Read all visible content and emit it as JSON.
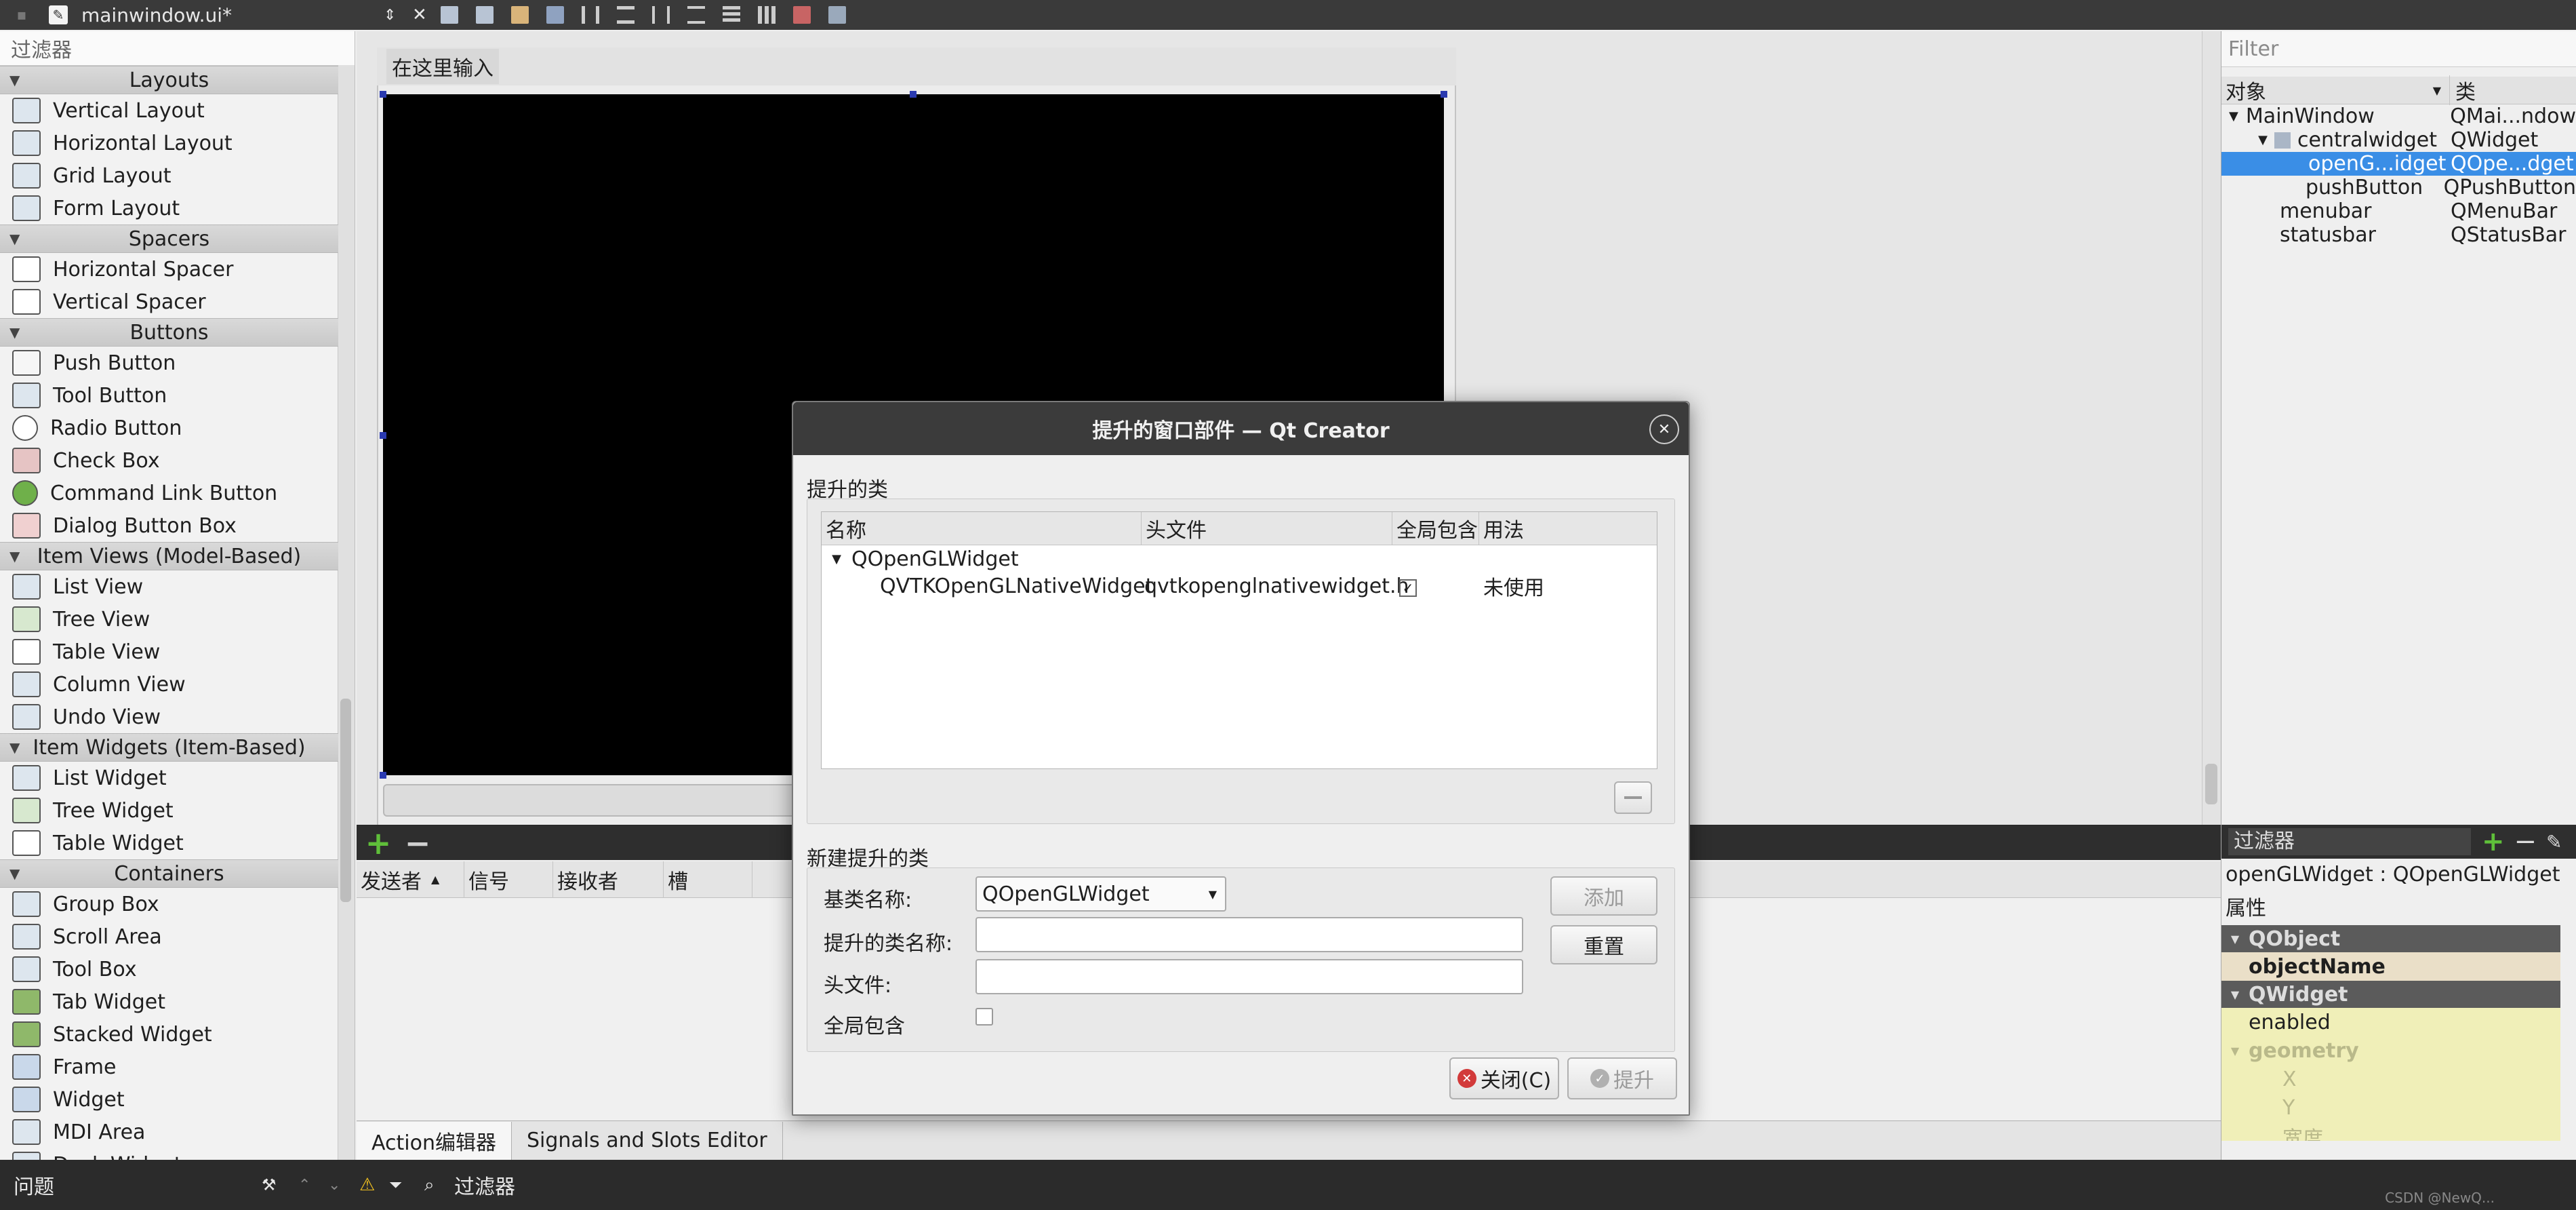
{
  "topbar": {
    "file_tab": "mainwindow.ui*"
  },
  "widgetbox": {
    "filter_placeholder": "过滤器",
    "categories": {
      "layouts": "Layouts",
      "spacers": "Spacers",
      "buttons": "Buttons",
      "item_views": "Item Views (Model-Based)",
      "item_widgets": "Item Widgets (Item-Based)",
      "containers": "Containers"
    },
    "layouts": [
      "Vertical Layout",
      "Horizontal Layout",
      "Grid Layout",
      "Form Layout"
    ],
    "spacers": [
      "Horizontal Spacer",
      "Vertical Spacer"
    ],
    "buttons": [
      "Push Button",
      "Tool Button",
      "Radio Button",
      "Check Box",
      "Command Link Button",
      "Dialog Button Box"
    ],
    "item_views": [
      "List View",
      "Tree View",
      "Table View",
      "Column View",
      "Undo View"
    ],
    "item_widgets": [
      "List Widget",
      "Tree Widget",
      "Table Widget"
    ],
    "containers": [
      "Group Box",
      "Scroll Area",
      "Tool Box",
      "Tab Widget",
      "Stacked Widget",
      "Frame",
      "Widget",
      "MDI Area",
      "Dock Widget"
    ]
  },
  "form": {
    "menu_placeholder": "在这里输入"
  },
  "signals": {
    "columns": [
      "发送者",
      "信号",
      "接收者",
      "槽"
    ],
    "tabs": [
      "Action编辑器",
      "Signals and Slots Editor"
    ]
  },
  "inspector": {
    "filter_placeholder": "Filter",
    "col_object": "对象",
    "col_class": "类",
    "tree": [
      {
        "name": "MainWindow",
        "cls": "QMai...ndow"
      },
      {
        "name": "centralwidget",
        "cls": "QWidget"
      },
      {
        "name": "openG...idget",
        "cls": "QOpe...dget"
      },
      {
        "name": "pushButton",
        "cls": "QPushButton"
      },
      {
        "name": "menubar",
        "cls": "QMenuBar"
      },
      {
        "name": "statusbar",
        "cls": "QStatusBar"
      }
    ]
  },
  "properties": {
    "filter_placeholder": "过滤器",
    "object_label": "openGLWidget : QOpenGLWidget",
    "header": "属性",
    "rows": [
      "QObject",
      "objectName",
      "QWidget",
      "enabled",
      "geometry",
      "X",
      "Y",
      "宽度"
    ]
  },
  "statusbar": {
    "problems": "问题",
    "filter_placeholder": "过滤器",
    "watermark": "CSDN @NewQ..."
  },
  "dialog": {
    "title": "提升的窗口部件 — Qt Creator",
    "promoted_group": "提升的类",
    "table_headers": [
      "名称",
      "头文件",
      "全局包含",
      "用法"
    ],
    "base_row": "QOpenGLWidget",
    "promoted_row": {
      "name": "QVTKOpenGLNativeWidget",
      "header": "qvtkopenglnativewidget.h",
      "global": true,
      "usage": "未使用"
    },
    "new_group": "新建提升的类",
    "base_label": "基类名称:",
    "base_value": "QOpenGLWidget",
    "class_label": "提升的类名称:",
    "class_value": "",
    "header_label": "头文件:",
    "header_value": "",
    "global_label": "全局包含",
    "global_checked": false,
    "add_button": "添加",
    "reset_button": "重置",
    "close_button": "关闭(C)",
    "promote_button": "提升"
  }
}
